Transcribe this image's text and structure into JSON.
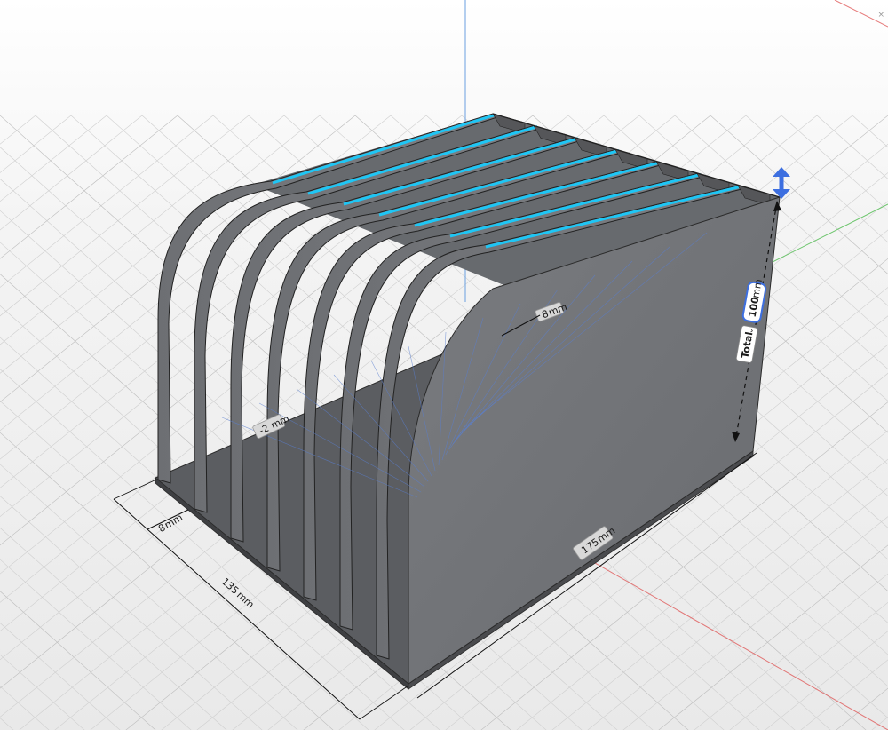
{
  "window": {
    "close_glyph": "×"
  },
  "dimensions": {
    "total_height_value": "100",
    "total_height_unit": "mm",
    "total_label": "Total",
    "depth_label": "175",
    "width_label": "135",
    "divider_spacing_label": "8",
    "thickness_label": "-2",
    "small_label": "8",
    "unit": "mm"
  },
  "colors": {
    "background": "#e9e9e9",
    "grid": "#cfcfcf",
    "grid_major": "#bdbdbd",
    "axis_x": "#e05a5a",
    "axis_y": "#6a9fe0",
    "axis_z": "#6ac46a",
    "model_face": "#717377",
    "model_side": "#8a8c90",
    "model_dark": "#555659",
    "edge_highlight": "#1ec6f5",
    "handle": "#3d6fe0"
  },
  "icons": {
    "resize_handle": "double-arrow-vertical-icon",
    "dropdown": "chevron-down-icon"
  }
}
